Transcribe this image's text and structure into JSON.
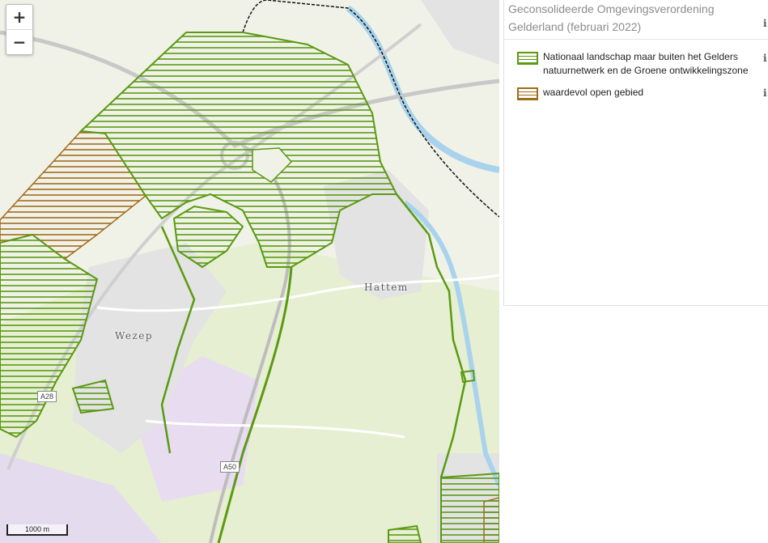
{
  "map": {
    "zoom_in": "+",
    "zoom_out": "−",
    "scale_label": "1000 m",
    "towns": {
      "hattem": "Hattem",
      "wezep": "Wezep"
    },
    "roads": {
      "a28": "A28",
      "a50": "A50"
    }
  },
  "legend": {
    "title": "Geconsolideerde Omgevingsverordening Gelderland (februari 2022)",
    "info_glyph": "i",
    "items": [
      {
        "label": "Nationaal landschap maar buiten het Gelders natuurnetwerk en de Groene ontwikkelingszone",
        "color": "#5a9a12"
      },
      {
        "label": "waardevol open gebied",
        "color": "#a36a1c"
      }
    ]
  }
}
